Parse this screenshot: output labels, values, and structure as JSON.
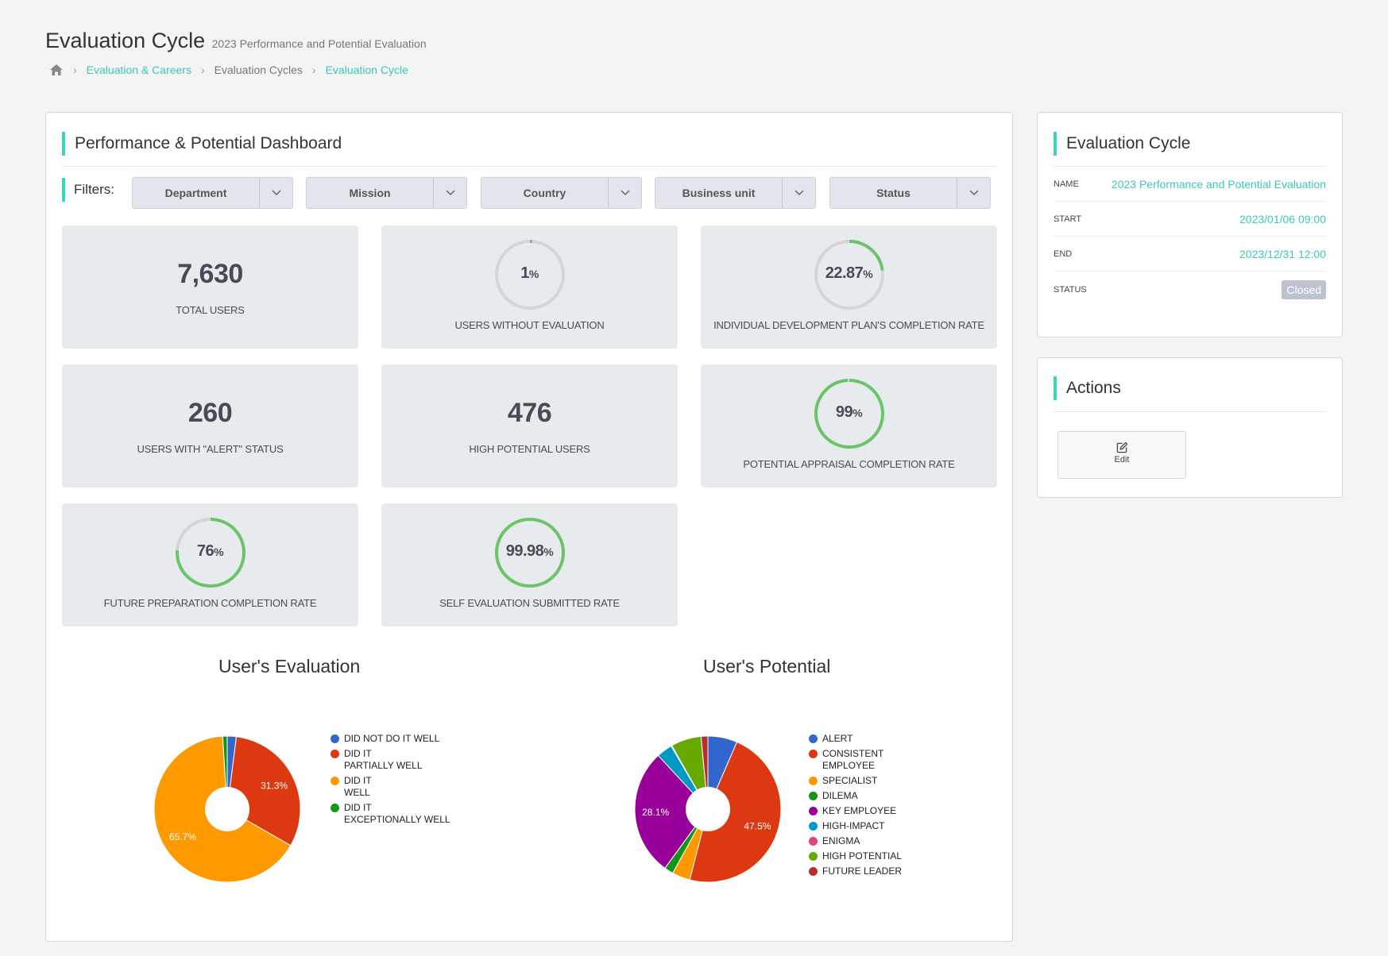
{
  "header": {
    "title": "Evaluation Cycle",
    "subtitle": "2023 Performance and Potential Evaluation"
  },
  "breadcrumb": {
    "home_icon": "home-icon",
    "items": [
      {
        "label": "Evaluation & Careers",
        "link": true
      },
      {
        "label": "Evaluation Cycles",
        "link": false
      },
      {
        "label": "Evaluation Cycle",
        "link": true
      }
    ]
  },
  "dashboard": {
    "title": "Performance & Potential Dashboard",
    "filters_label": "Filters:",
    "filters": [
      {
        "label": "Department"
      },
      {
        "label": "Mission"
      },
      {
        "label": "Country"
      },
      {
        "label": "Business unit"
      },
      {
        "label": "Status"
      }
    ],
    "tiles": {
      "total_users": {
        "value": "7,630",
        "caption": "TOTAL USERS"
      },
      "users_without_evaluation": {
        "value": "1",
        "unit": "%",
        "percent": 1,
        "caption": "USERS WITHOUT EVALUATION"
      },
      "idp_completion": {
        "value": "22.87",
        "unit": "%",
        "percent": 22.87,
        "caption": "INDIVIDUAL DEVELOPMENT PLAN'S COMPLETION RATE"
      },
      "alert_users": {
        "value": "260",
        "caption": "USERS WITH \"ALERT\" STATUS"
      },
      "high_potential_users": {
        "value": "476",
        "caption": "HIGH POTENTIAL USERS"
      },
      "potential_appraisal": {
        "value": "99",
        "unit": "%",
        "percent": 99,
        "caption": "POTENTIAL APPRAISAL COMPLETION RATE"
      },
      "future_preparation": {
        "value": "76",
        "unit": "%",
        "percent": 76,
        "caption": "FUTURE PREPARATION COMPLETION RATE"
      },
      "self_evaluation": {
        "value": "99.98",
        "unit": "%",
        "percent": 99.98,
        "caption": "SELF EVALUATION SUBMITTED RATE"
      }
    },
    "colors": {
      "accent": "#3cd4bb",
      "gauge_fill": "#6cc46a",
      "gauge_track": "#d3d5d7"
    }
  },
  "chart_data": [
    {
      "type": "pie",
      "title": "User's Evaluation",
      "donut": true,
      "legend_position": "right",
      "categories": [
        "DID NOT DO IT WELL",
        "DID IT PARTIALLY WELL",
        "DID IT WELL",
        "DID IT EXCEPTIONALLY WELL"
      ],
      "legend_lines": [
        [
          "DID NOT DO IT WELL"
        ],
        [
          "DID IT",
          "PARTIALLY WELL"
        ],
        [
          "DID IT",
          "WELL"
        ],
        [
          "DID IT",
          "EXCEPTIONALLY WELL"
        ]
      ],
      "values": [
        2.0,
        31.3,
        65.7,
        1.0
      ],
      "labels": [
        "",
        "31.3%",
        "65.7%",
        ""
      ],
      "colors": [
        "#3366cc",
        "#dc3912",
        "#ff9900",
        "#109618"
      ]
    },
    {
      "type": "pie",
      "title": "User's Potential",
      "donut": true,
      "legend_position": "right",
      "categories": [
        "ALERT",
        "CONSISTENT EMPLOYEE",
        "SPECIALIST",
        "DILEMA",
        "KEY EMPLOYEE",
        "HIGH-IMPACT",
        "ENIGMA",
        "HIGH POTENTIAL",
        "FUTURE LEADER"
      ],
      "legend_lines": [
        [
          "ALERT"
        ],
        [
          "CONSISTENT",
          "EMPLOYEE"
        ],
        [
          "SPECIALIST"
        ],
        [
          "DILEMA"
        ],
        [
          "KEY EMPLOYEE"
        ],
        [
          "HIGH-IMPACT"
        ],
        [
          "ENIGMA"
        ],
        [
          "HIGH POTENTIAL"
        ],
        [
          "FUTURE LEADER"
        ]
      ],
      "values": [
        6.5,
        47.5,
        4.0,
        2.0,
        28.1,
        3.5,
        0.2,
        6.7,
        1.5
      ],
      "labels": [
        "",
        "47.5%",
        "",
        "",
        "28.1%",
        "",
        "",
        "",
        ""
      ],
      "colors": [
        "#3366cc",
        "#dc3912",
        "#ff9900",
        "#109618",
        "#990099",
        "#0099c6",
        "#dd4477",
        "#66aa00",
        "#b82e2e"
      ]
    }
  ],
  "evaluation_cycle": {
    "title": "Evaluation Cycle",
    "rows": [
      {
        "key": "NAME",
        "value": "2023 Performance and Potential Evaluation"
      },
      {
        "key": "START",
        "value": "2023/01/06 09:00"
      },
      {
        "key": "END",
        "value": "2023/12/31 12:00"
      },
      {
        "key": "STATUS",
        "value": "Closed"
      }
    ]
  },
  "actions": {
    "title": "Actions",
    "edit_label": "Edit",
    "edit_icon": "edit-icon"
  }
}
